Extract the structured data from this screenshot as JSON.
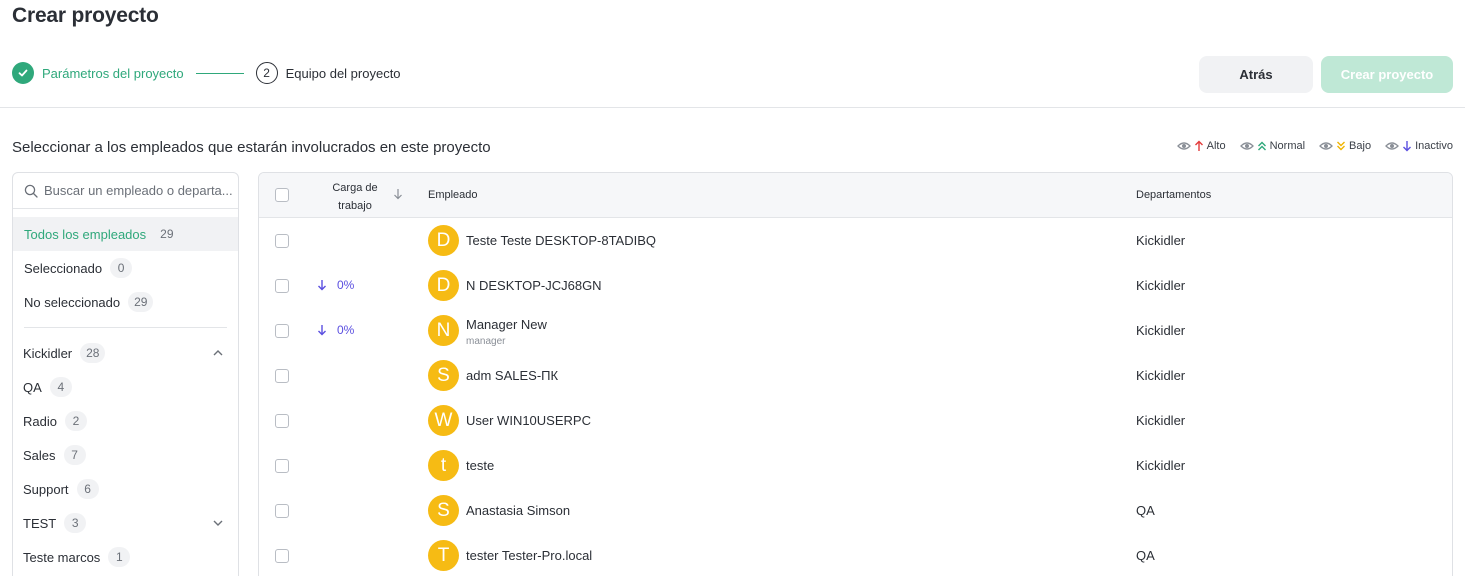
{
  "page": {
    "title": "Crear proyecto"
  },
  "stepper": {
    "step1": {
      "label": "Parámetros del proyecto",
      "status": "done"
    },
    "step2": {
      "number": "2",
      "label": "Equipo del proyecto",
      "status": "current"
    }
  },
  "actions": {
    "back": "Atrás",
    "create": "Crear proyecto"
  },
  "section": {
    "title": "Seleccionar a los empleados que estarán involucrados en este proyecto"
  },
  "legend": {
    "alto": {
      "label": "Alto",
      "color": "#e23b3b"
    },
    "normal": {
      "label": "Normal",
      "color": "#2fa87b"
    },
    "bajo": {
      "label": "Bajo",
      "color": "#f0b400"
    },
    "inactivo": {
      "label": "Inactivo",
      "color": "#5b4fe0"
    }
  },
  "sidebar": {
    "search_placeholder": "Buscar un empleado o departa...",
    "filters": [
      {
        "label": "Todos los empleados",
        "count": "29"
      },
      {
        "label": "Seleccionado",
        "count": "0"
      },
      {
        "label": "No seleccionado",
        "count": "29"
      }
    ],
    "departments": [
      {
        "label": "Kickidler",
        "count": "28",
        "chevron": "up"
      },
      {
        "label": "QA",
        "count": "4"
      },
      {
        "label": "Radio",
        "count": "2"
      },
      {
        "label": "Sales",
        "count": "7"
      },
      {
        "label": "Support",
        "count": "6"
      },
      {
        "label": "TEST",
        "count": "3",
        "chevron": "down"
      },
      {
        "label": "Teste marcos",
        "count": "1"
      }
    ]
  },
  "table": {
    "headers": {
      "load": "Carga de trabajo",
      "employee": "Empleado",
      "departments": "Departamentos"
    },
    "rows": [
      {
        "initial": "D",
        "name": "Teste Teste DESKTOP-8TADIBQ",
        "sub": "",
        "load": "",
        "dept": "Kickidler"
      },
      {
        "initial": "D",
        "name": "N DESKTOP-JCJ68GN",
        "sub": "",
        "load": "0%",
        "dept": "Kickidler"
      },
      {
        "initial": "N",
        "name": "Manager New",
        "sub": "manager",
        "load": "0%",
        "dept": "Kickidler"
      },
      {
        "initial": "S",
        "name": "adm SALES-ПК",
        "sub": "",
        "load": "",
        "dept": "Kickidler"
      },
      {
        "initial": "W",
        "name": "User WIN10USERPC",
        "sub": "",
        "load": "",
        "dept": "Kickidler"
      },
      {
        "initial": "t",
        "name": "teste",
        "sub": "",
        "load": "",
        "dept": "Kickidler"
      },
      {
        "initial": "S",
        "name": "Anastasia Simson",
        "sub": "",
        "load": "",
        "dept": "QA"
      },
      {
        "initial": "T",
        "name": "tester Tester-Pro.local",
        "sub": "",
        "load": "",
        "dept": "QA"
      }
    ]
  }
}
